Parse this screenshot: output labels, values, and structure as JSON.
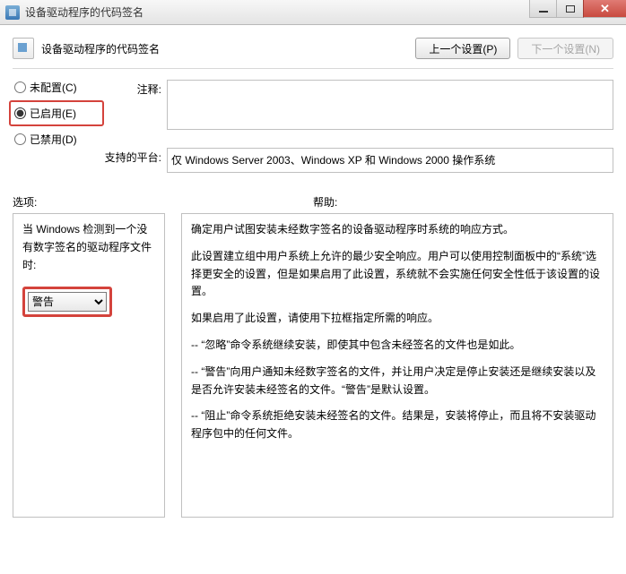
{
  "window": {
    "title": "设备驱动程序的代码签名"
  },
  "header": {
    "title": "设备驱动程序的代码签名",
    "prev_btn": "上一个设置(P)",
    "next_btn": "下一个设置(N)"
  },
  "radios": {
    "unconfigured": "未配置(C)",
    "enabled": "已启用(E)",
    "disabled": "已禁用(D)"
  },
  "fields": {
    "notes_label": "注释:",
    "notes_value": "",
    "platform_label": "支持的平台:",
    "platform_value": "仅 Windows Server 2003、Windows XP 和 Windows 2000 操作系统"
  },
  "sections": {
    "options_label": "选项:",
    "help_label": "帮助:"
  },
  "options": {
    "detect_text": "当 Windows 检测到一个没有数字签名的驱动程序文件时:",
    "combo_value": "警告"
  },
  "help": {
    "p1": "确定用户试图安装未经数字签名的设备驱动程序时系统的响应方式。",
    "p2": "此设置建立组中用户系统上允许的最少安全响应。用户可以使用控制面板中的“系统”选择更安全的设置，但是如果启用了此设置，系统就不会实施任何安全性低于该设置的设置。",
    "p3": "如果启用了此设置，请使用下拉框指定所需的响应。",
    "p4": "-- “忽略”命令系统继续安装，即使其中包含未经签名的文件也是如此。",
    "p5": "-- “警告”向用户通知未经数字签名的文件，并让用户决定是停止安装还是继续安装以及是否允许安装未经签名的文件。“警告”是默认设置。",
    "p6": "-- “阻止”命令系统拒绝安装未经签名的文件。结果是，安装将停止，而且将不安装驱动程序包中的任何文件。"
  }
}
